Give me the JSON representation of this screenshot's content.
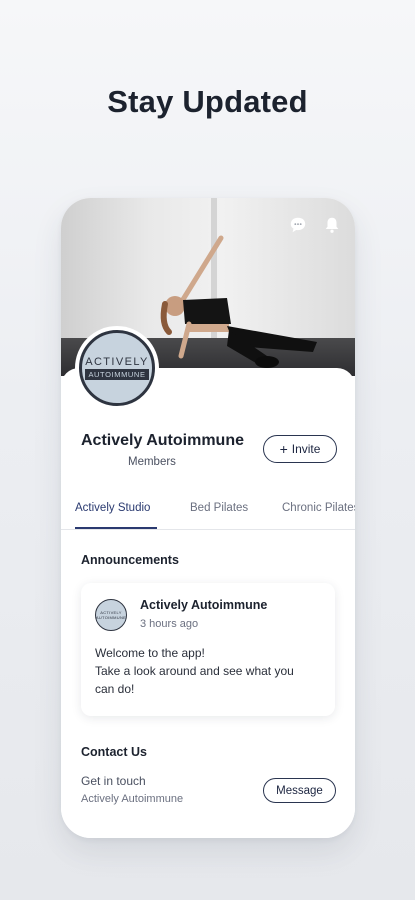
{
  "headline": "Stay Updated",
  "hero": {
    "icons": [
      "chat-icon",
      "bell-icon"
    ]
  },
  "group": {
    "logo_line1": "ACTIVELY",
    "logo_line2": "AUTOIMMUNE",
    "name": "Actively Autoimmune",
    "members_label": "Members",
    "invite_label": "Invite",
    "invite_icon": "plus-icon"
  },
  "tabs": [
    {
      "label": "Actively Studio",
      "active": true
    },
    {
      "label": "Bed Pilates",
      "active": false
    },
    {
      "label": "Chronic Pilates",
      "active": false
    }
  ],
  "announcements": {
    "title": "Announcements",
    "post": {
      "author": "Actively Autoimmune",
      "time": "3 hours ago",
      "lines": [
        "Welcome to the app!",
        "Take a look around and see what you",
        "can do!"
      ],
      "avatar_line1": "ACTIVELY",
      "avatar_line2": "AUTOIMMUNE"
    }
  },
  "contact": {
    "title": "Contact Us",
    "subtitle": "Get in touch",
    "org": "Actively Autoimmune",
    "message_label": "Message"
  },
  "colors": {
    "accent": "#2a3a70",
    "logo_bg": "#c7d3de",
    "logo_border": "#2e3440"
  }
}
